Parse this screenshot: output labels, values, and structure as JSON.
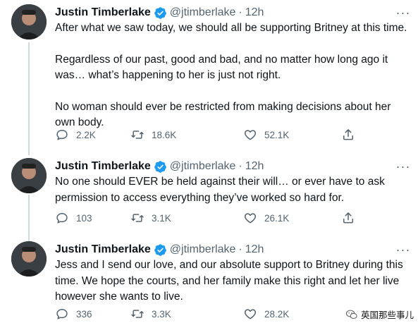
{
  "tweets": [
    {
      "author": "Justin Timberlake",
      "handle": "@jtimberlake",
      "separator": "·",
      "time": "12h",
      "paragraphs": [
        "After what we saw today, we should all be supporting Britney at this time.",
        "Regardless of our past, good and bad, and no matter how long ago it was… what’s happening to her is just not right.",
        "No woman should ever be restricted from making decisions about her own body."
      ],
      "replies": "2.2K",
      "retweets": "18.6K",
      "likes": "52.1K"
    },
    {
      "author": "Justin Timberlake",
      "handle": "@jtimberlake",
      "separator": "·",
      "time": "12h",
      "paragraphs": [
        "No one should EVER be held against their will… or ever have to ask permission to access everything they’ve worked so hard for."
      ],
      "replies": "103",
      "retweets": "3.1K",
      "likes": "26.1K"
    },
    {
      "author": "Justin Timberlake",
      "handle": "@jtimberlake",
      "separator": "·",
      "time": "12h",
      "paragraphs": [
        "Jess and I send our love, and our absolute support to Britney during this time. We hope the courts, and her family make this right and let her live however she wants to live."
      ],
      "replies": "336",
      "retweets": "3.3K",
      "likes": "28.2K"
    }
  ],
  "icons": {
    "verified": "verified-badge-icon",
    "more": "more-options-icon",
    "reply": "reply-icon",
    "retweet": "retweet-icon",
    "like": "heart-icon",
    "share": "share-icon",
    "watermark": "wechat-icon"
  },
  "colors": {
    "verified": "#1d9bf0",
    "muted": "#536471",
    "text": "#0f1419",
    "thread_line": "#cfd9de"
  },
  "more_glyph": "···",
  "watermark_text": "英国那些事儿"
}
